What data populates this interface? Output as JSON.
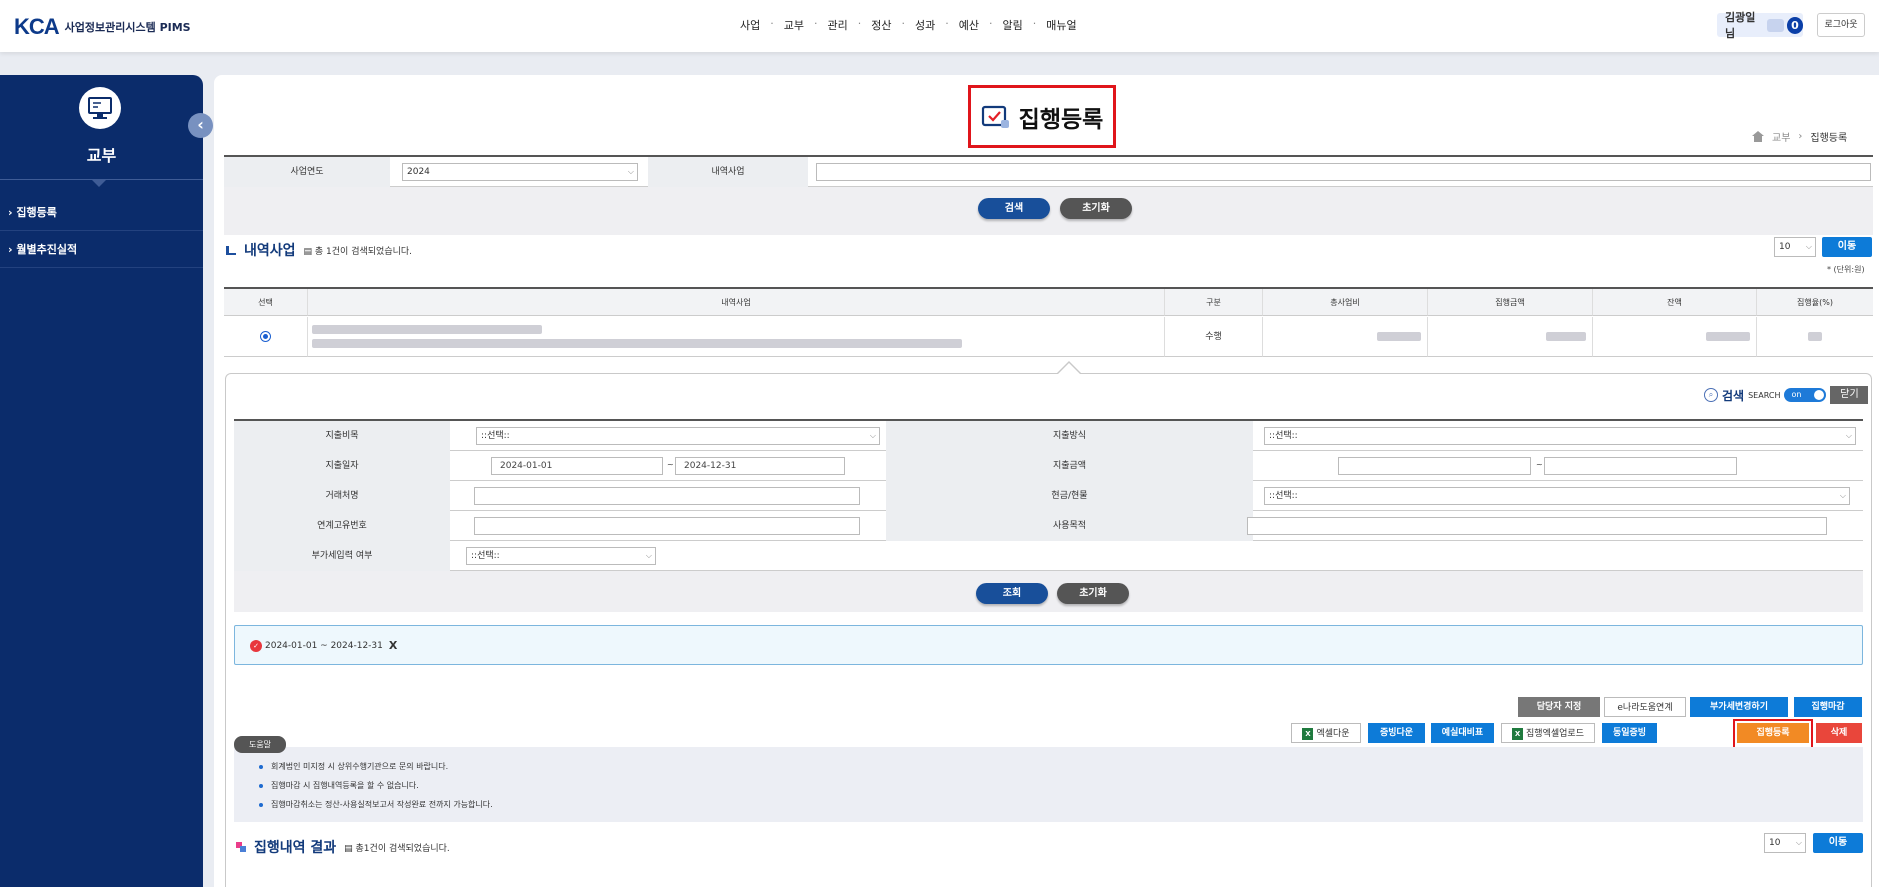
{
  "header": {
    "logo_mark": "KCA",
    "logo_text": "사업정보관리시스템 PIMS",
    "menu": [
      "사업",
      "교부",
      "관리",
      "정산",
      "성과",
      "예산",
      "알림",
      "매뉴얼"
    ],
    "user": "김광일님",
    "alert_count": "0",
    "logout": "로그아웃"
  },
  "sidebar": {
    "title": "교부",
    "items": [
      "집행등록",
      "월별추진실적"
    ],
    "toggle": "‹"
  },
  "page": {
    "title": "집행등록",
    "breadcrumb": [
      "교부",
      "집행등록"
    ]
  },
  "search1": {
    "year_label": "사업연도",
    "year_value": "2024",
    "project_label": "내역사업",
    "search_btn": "검색",
    "reset_btn": "초기화"
  },
  "list1": {
    "title": "내역사업",
    "count_text": "총 1건이 검색되었습니다.",
    "count_strong": "1",
    "page_size": "10",
    "move_btn": "이동",
    "unit": "* (단위:원)",
    "columns": [
      "선택",
      "내역사업",
      "구분",
      "총사업비",
      "집행금액",
      "잔액",
      "집행율(%)"
    ],
    "row": {
      "type": "수행"
    }
  },
  "filter": {
    "search_label": "검색",
    "search_en": "SEARCH",
    "toggle": "on",
    "close": "닫기",
    "fields": {
      "expense_item": "지출비목",
      "expense_method": "지출방식",
      "expense_date": "지출일자",
      "expense_amount": "지출금액",
      "vendor": "거래처명",
      "cash_goods": "현금/현물",
      "link_no": "연계고유번호",
      "purpose": "사용목적",
      "vat": "부가세입력 여부"
    },
    "select_placeholder": "::선택::",
    "date_from": "2024-01-01",
    "date_to": "2024-12-31",
    "tilde": "~",
    "query_btn": "조회",
    "reset_btn": "초기화",
    "chip": "2024-01-01 ~ 2024-12-31",
    "chip_close": "X"
  },
  "actions": {
    "assign": "담당자 지정",
    "enara": "e나라도움연계",
    "vat_change": "부가세변경하기",
    "close_exec": "집행마감",
    "excel_down": "엑셀다운",
    "evidence_down": "증빙다운",
    "budget_compare": "예실대비표",
    "excel_upload": "집행엑셀업로드",
    "same_evidence": "동일증빙",
    "register": "집행등록",
    "delete": "삭제"
  },
  "help": {
    "tag": "도움말",
    "items": [
      "회계법인 미지정 시 상위수행기관으로 문의 바랍니다.",
      "집행마감 시 집행내역등록을 할 수 없습니다.",
      "집행마감취소는 정산-사용실적보고서 작성완료 전까지 가능합니다."
    ]
  },
  "result": {
    "title": "집행내역 결과",
    "count_text": "총1건이 검색되었습니다.",
    "page_size": "10",
    "move_btn": "이동"
  }
}
